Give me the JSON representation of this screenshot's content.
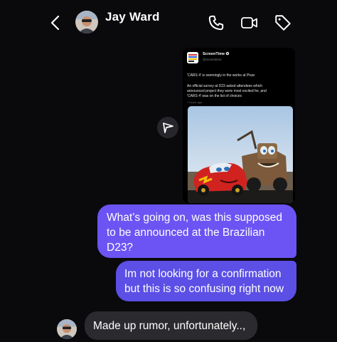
{
  "header": {
    "contact_name": "Jay Ward",
    "back_icon": "chevron-left-icon",
    "call_icon": "phone-icon",
    "video_icon": "video-camera-icon",
    "tag_icon": "tag-icon"
  },
  "shared_post": {
    "account_name": "ScreenTime ✪",
    "handle": "@screentime",
    "lines": [
      "'CARS 4' is seemingly in the works at Pixar",
      "",
      "An official survey at D23 asked attendees which",
      "announced project they were most excited for, and",
      "'CARS 4' was on the list of choices"
    ],
    "timestamp": "7 hours ago",
    "image_alt": "Lightning McQueen and Mater"
  },
  "forward_button_icon": "paper-plane-icon",
  "messages": {
    "sent_1": [
      "What’s going on, was this supposed",
      "to be announced at the Brazilian",
      "D23?"
    ],
    "sent_2": [
      "Im not looking for a confirmation",
      "but this is so confusing right now"
    ],
    "received_1": "Made up rumor, unfortunately..,"
  },
  "colors": {
    "background": "#0a0a0c",
    "sent_bubble": "#6b54f3",
    "received_bubble": "#2b2b2f"
  }
}
